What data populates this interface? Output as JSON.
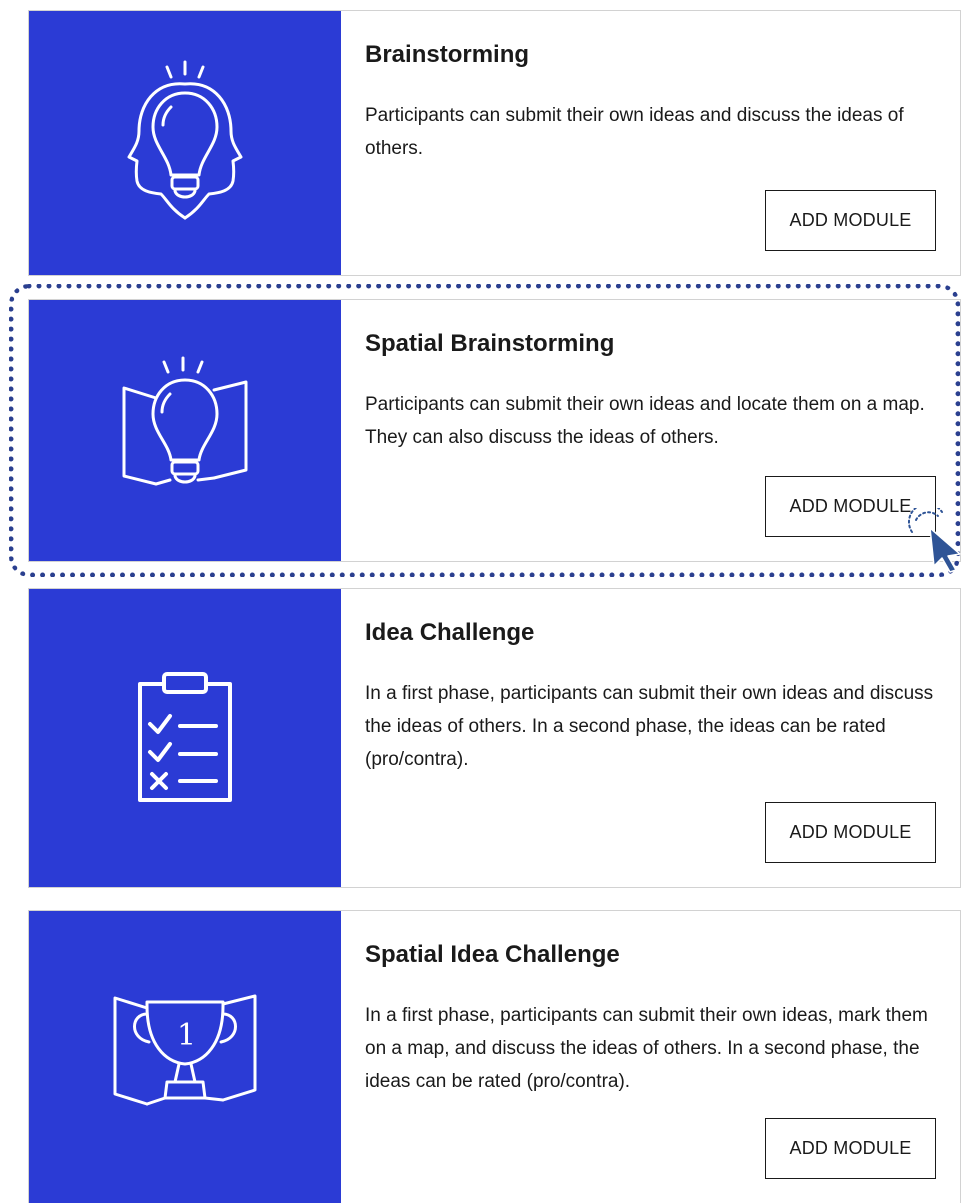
{
  "colors": {
    "panel": "#2b3bd5",
    "highlight": "#2a3f8f",
    "cursor": "#2f5496"
  },
  "modules": [
    {
      "title": "Brainstorming",
      "description": "Participants can submit their own ideas and discuss the ideas of others.",
      "button_label": "ADD MODULE",
      "icon": "lightbulb-two-faces-icon"
    },
    {
      "title": "Spatial Brainstorming",
      "description": "Participants can submit their own ideas and locate them on a map. They can also discuss the ideas of others.",
      "button_label": "ADD MODULE",
      "icon": "lightbulb-map-icon"
    },
    {
      "title": "Idea Challenge",
      "description": "In a first phase, participants can submit their own ideas and discuss the ideas of others. In a second phase, the ideas can be rated (pro/contra).",
      "button_label": "ADD MODULE",
      "icon": "clipboard-checklist-icon"
    },
    {
      "title": "Spatial Idea Challenge",
      "description": "In a first phase, participants can submit their own ideas, mark them on a map, and discuss the ideas of others. In a second phase, the ideas can be rated (pro/contra).",
      "button_label": "ADD MODULE",
      "icon": "trophy-map-icon",
      "icon_text": "1"
    }
  ]
}
